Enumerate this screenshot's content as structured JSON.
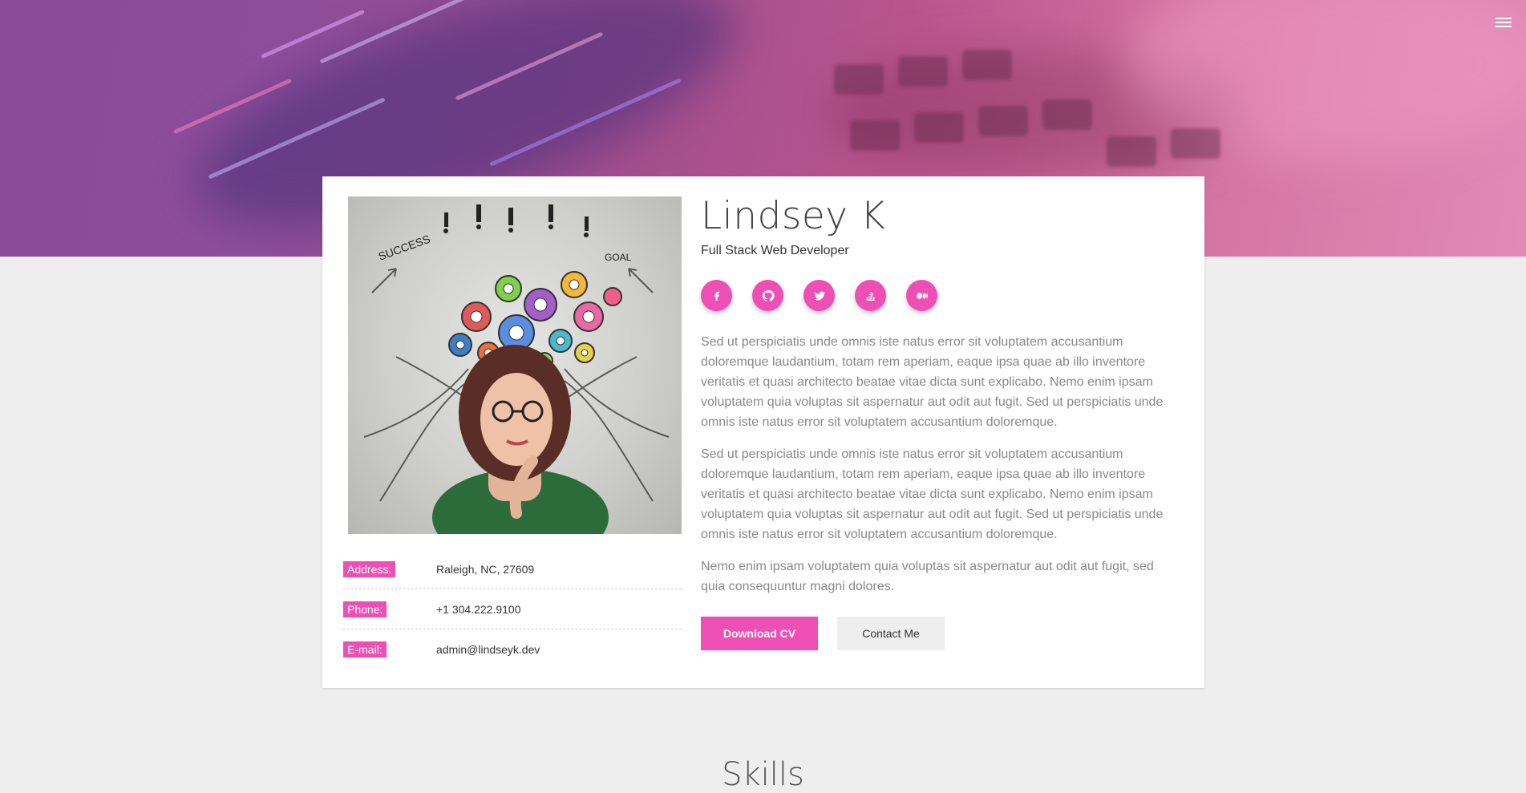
{
  "header": {
    "menu_icon": "hamburger-menu-icon"
  },
  "profile": {
    "name": "Lindsey K",
    "title": "Full Stack Web Developer",
    "socials": [
      {
        "name": "facebook-icon"
      },
      {
        "name": "github-icon"
      },
      {
        "name": "twitter-icon"
      },
      {
        "name": "stackoverflow-icon"
      },
      {
        "name": "medium-icon"
      }
    ],
    "paragraphs": [
      "Sed ut perspiciatis unde omnis iste natus error sit voluptatem accusantium doloremque laudantium, totam rem aperiam, eaque ipsa quae ab illo inventore veritatis et quasi architecto beatae vitae dicta sunt explicabo. Nemo enim ipsam voluptatem quia voluptas sit aspernatur aut odit aut fugit. Sed ut perspiciatis unde omnis iste natus error sit voluptatem accusantium doloremque.",
      "Sed ut perspiciatis unde omnis iste natus error sit voluptatem accusantium doloremque laudantium, totam rem aperiam, eaque ipsa quae ab illo inventore veritatis et quasi architecto beatae vitae dicta sunt explicabo. Nemo enim ipsam voluptatem quia voluptas sit aspernatur aut odit aut fugit. Sed ut perspiciatis unde omnis iste natus error sit voluptatem accusantium doloremque.",
      "Nemo enim ipsam voluptatem quia voluptas sit aspernatur aut odit aut fugit, sed quia consequuntur magni dolores."
    ],
    "buttons": {
      "download": "Download CV",
      "contact": "Contact Me"
    },
    "info": [
      {
        "label": "Address:",
        "value": "Raleigh, NC, 27609"
      },
      {
        "label": "Phone:",
        "value": "+1 304.222.9100"
      },
      {
        "label": "E-mail:",
        "value": "admin@lindseyk.dev"
      }
    ]
  },
  "sections": {
    "skills_title": "Skills"
  },
  "colors": {
    "accent": "#ee4fb5",
    "background": "#eeeeee",
    "card": "#ffffff"
  }
}
